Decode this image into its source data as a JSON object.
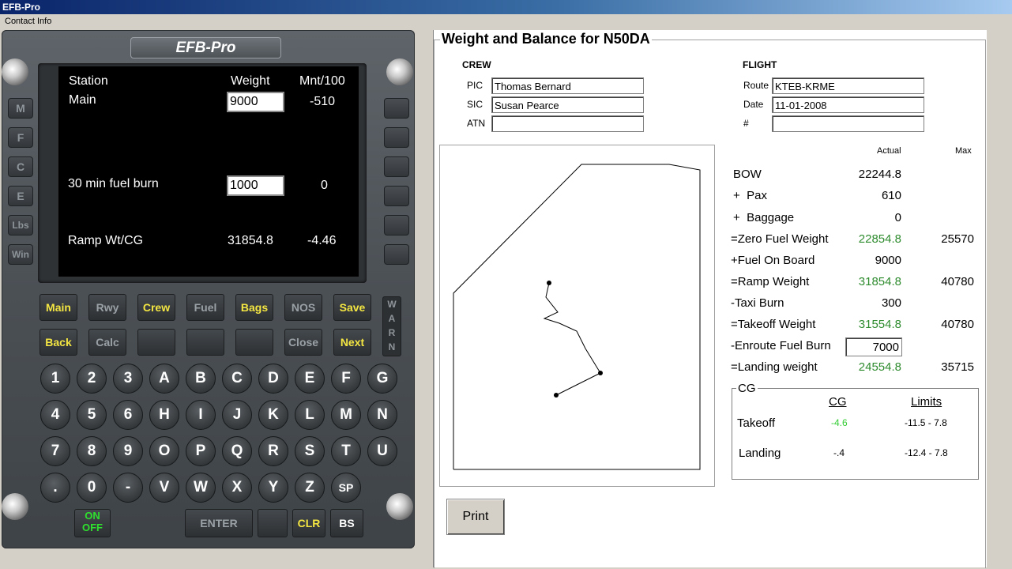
{
  "window": {
    "title": "EFB-Pro"
  },
  "menu": {
    "items": [
      "Contact Info"
    ]
  },
  "device": {
    "brand": "EFB-Pro",
    "left_keys": [
      "M",
      "F",
      "C",
      "E",
      "Lbs",
      "Win"
    ],
    "screen": {
      "col_station": "Station",
      "col_weight": "Weight",
      "col_moment": "Mnt/100",
      "row1_label": "Main",
      "row1_weight": "9000",
      "row1_moment": "-510",
      "row2_label": "30 min fuel burn",
      "row2_weight": "1000",
      "row2_moment": "0",
      "row3_label": "Ramp Wt/CG",
      "row3_weight": "31854.8",
      "row3_moment": "-4.46"
    },
    "func_row1": [
      "Main",
      "Rwy",
      "Crew",
      "Fuel",
      "Bags",
      "NOS",
      "Save"
    ],
    "func_row2": [
      "Back",
      "Calc",
      "",
      "",
      "",
      "Close",
      "Next"
    ],
    "warn": [
      "W",
      "A",
      "R",
      "N"
    ],
    "keys_row1": [
      "1",
      "2",
      "3",
      "A",
      "B",
      "C",
      "D",
      "E",
      "F",
      "G"
    ],
    "keys_row2": [
      "4",
      "5",
      "6",
      "H",
      "I",
      "J",
      "K",
      "L",
      "M",
      "N"
    ],
    "keys_row3": [
      "7",
      "8",
      "9",
      "O",
      "P",
      "Q",
      "R",
      "S",
      "T",
      "U"
    ],
    "keys_row4": [
      ".",
      "0",
      "-",
      "V",
      "W",
      "X",
      "Y",
      "Z",
      "SP"
    ],
    "onoff": [
      "ON",
      "OFF"
    ],
    "enter": "ENTER",
    "clr": "CLR",
    "bs": "BS",
    "colors": {
      "yellow": "#f4e642",
      "green": "#2fe02f"
    }
  },
  "wb": {
    "title": "Weight and Balance for N50DA",
    "crew": {
      "heading": "CREW",
      "pic_label": "PIC",
      "pic": "Thomas Bernard",
      "sic_label": "SIC",
      "sic": "Susan Pearce",
      "atn_label": "ATN",
      "atn": ""
    },
    "flight": {
      "heading": "FLIGHT",
      "route_label": "Route",
      "route": "KTEB-KRME",
      "date_label": "Date",
      "date": "11-01-2008",
      "num_label": "#",
      "num": ""
    },
    "table": {
      "col_actual": "Actual",
      "col_max": "Max",
      "bow_label": "BOW",
      "bow": "22244.8",
      "pax_label": "+  Pax",
      "pax": "610",
      "bag_label": "+  Baggage",
      "bag": "0",
      "zfw_label": "=Zero Fuel Weight",
      "zfw": "22854.8",
      "zfw_max": "25570",
      "fob_label": "+Fuel On Board",
      "fob": "9000",
      "ramp_label": "=Ramp Weight",
      "ramp": "31854.8",
      "ramp_max": "40780",
      "taxi_label": "-Taxi Burn",
      "taxi": "300",
      "tow_label": "=Takeoff Weight",
      "tow": "31554.8",
      "tow_max": "40780",
      "enroute_label": "-Enroute Fuel Burn",
      "enroute": "7000",
      "lw_label": "=Landing weight",
      "lw": "24554.8",
      "lw_max": "35715"
    },
    "cg": {
      "heading": "CG",
      "col_cg": "CG",
      "col_limits": "Limits",
      "takeoff_label": "Takeoff",
      "takeoff_cg": "-4.6",
      "takeoff_limits": "-11.5 - 7.8",
      "landing_label": "Landing",
      "landing_cg": "-.4",
      "landing_limits": "-12.4 - 7.8"
    },
    "print": "Print",
    "colors": {
      "green": "#2e8b2e",
      "takeoff_cg": "#33cc33"
    }
  }
}
